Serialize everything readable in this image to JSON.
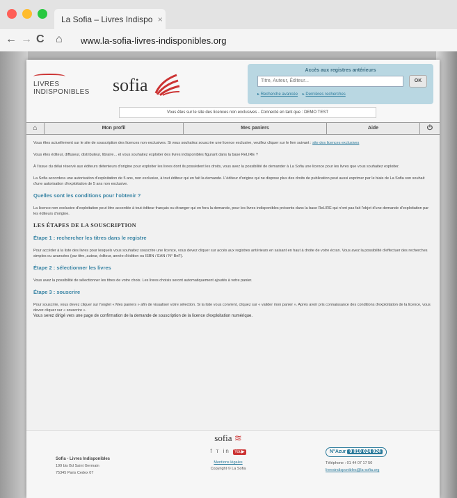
{
  "browser": {
    "tab_title": "La Sofia – Livres Indispo",
    "tab_close": "×",
    "url": "www.la-sofia-livres-indisponibles.org",
    "colors": {
      "close": "#ff5f57",
      "minimize": "#febc2e",
      "maximize": "#28c840"
    },
    "nav_icons": [
      "back-icon",
      "forward-icon",
      "reload-icon",
      "home-icon"
    ]
  },
  "header": {
    "logo_livres": "LIVRES",
    "logo_indisponibles": "INDISPONIBLES",
    "logo_sofia": "sofia",
    "search": {
      "title": "Accès aux registres antérieurs",
      "placeholder": "Titre, Auteur, Éditeur...",
      "ok_label": "OK",
      "advanced_link": "Recherche avancée",
      "last_link": "Dernières recherches"
    },
    "notice": "Vous êtes sur le site des licences non exclusives - Connecté en tant que : DEMO TEST"
  },
  "menu": {
    "home_icon": "home-icon",
    "profile": "Mon profil",
    "cart": "Mes paniers",
    "help": "Aide",
    "power_icon": "power-icon"
  },
  "content": {
    "p1": "Vous êtes actuellement sur le site de souscription des licences non exclusives. Si vous souhaitez souscrire une licence exclusive, veuillez cliquer sur le lien suivant :",
    "p1_link": "site des licences exclusives",
    "p2": "Vous êtes éditeur, diffuseur, distributeur, libraire... et vous souhaitez exploiter des livres indisponibles figurant dans la base ReLIRE ?",
    "p3": "À l'issue du délai réservé aux éditeurs détenteurs d'origine pour exploiter les livres dont ils possèdent les droits, vous avez la possibilité de demander à La Sofia une licence pour les livres que vous souhaitez exploiter.",
    "p4": "La Sofia accordera une autorisation d'exploitation de 5 ans, non exclusive, à tout éditeur qui en fait la demande. L'éditeur d'origine qui ne dispose plus des droits de publication peut aussi exprimer par le biais de La Sofia son souhait d'une autorisation d'exploitation de 5 ans non exclusive.",
    "h_conditions": "Quelles sont les conditions pour l'obtenir ?",
    "p5": "La licence non exclusive d'exploitation peut être accordée à tout éditeur français ou étranger qui en fera la demande, pour les livres indisponibles présents dans la base ReLIRE qui n'ont pas fait l'objet d'une demande d'exploitation par les éditeurs d'origine.",
    "h_steps": "LES ÉTAPES DE LA SOUSCRIPTION",
    "h_step1": "Étape 1 : rechercher les titres dans le registre",
    "p6": "Pour accéder à la liste des livres pour lesquels vous souhaitez souscrire une licence, vous devez cliquer sur accès aux registres antérieurs en saisant en haut à droite de votre écran. Vous avez la possibilité d'effectuer des recherches simples ou avancées (par titre, auteur, éditeur, année d'édition ou ISBN / EAN / N° BnF).",
    "h_step2": "Étape 2 : sélectionner les livres",
    "p7": "Vous avez la possibilité de sélectionner les titres de votre choix. Les livres choisis seront automatiquement ajoutés à votre panier.",
    "h_step3": "Étape 3 : souscrire",
    "p8a": "Pour souscrire, vous devez cliquer sur l'onglet « Mes paniers » afin de visualiser votre sélection. Si la liste vous convient, cliquez sur « valider mon panier ». Après avoir pris connaissance des conditions d'exploitation de la licence, vous devez cliquer sur « souscrire ».",
    "p8b": "Vous serez dirigé vers une page de confirmation de la demande de souscription de la licence d'exploitation numérique."
  },
  "footer": {
    "org_name": "Sofia - Livres Indisponibles",
    "address1": "199 bis Bd Saint Germain",
    "address2": "75345 Paris Cedex 07",
    "sofia": "sofia",
    "social": [
      "facebook-icon",
      "twitter-icon",
      "linkedin-icon",
      "youtube-icon"
    ],
    "legal": "Mentions légales",
    "copyright": "Copyright © La Sofia",
    "azur_label": "N°Azur",
    "azur_number": "0 810 024 024",
    "phone": "Téléphone : 01 44 07 17 50",
    "email": "livresindisponibles@la-sofia.org"
  }
}
